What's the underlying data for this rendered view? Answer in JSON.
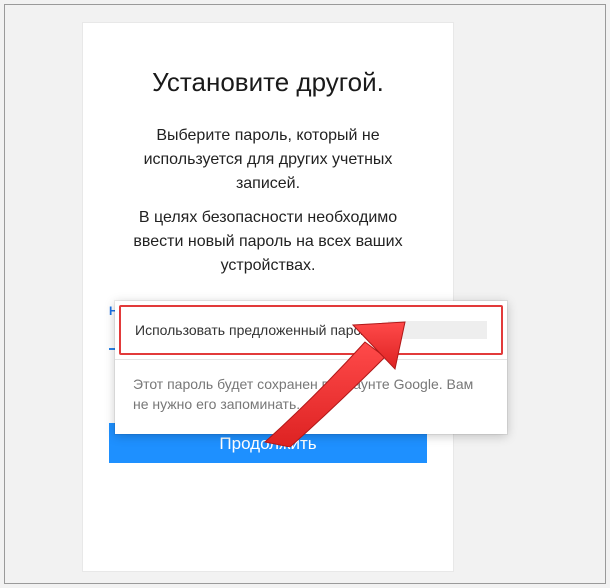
{
  "title": "Установите другой.",
  "description": {
    "p1": "Выберите пароль, который не используется для других учетных записей.",
    "p2": "В целях безопасности необходимо ввести новый пароль на всех ваших устройствах."
  },
  "field": {
    "label": "Новый пароль",
    "value": ""
  },
  "popover": {
    "suggest_label": "Использовать предложенный пароль",
    "note": "Этот пароль будет сохранен в аккаунте Google. Вам не нужно его запоминать."
  },
  "button": {
    "continue": "Продолжить"
  }
}
